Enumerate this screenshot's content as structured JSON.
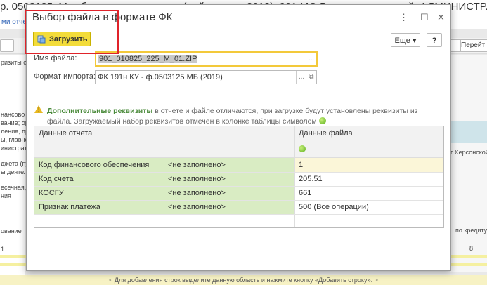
{
  "background": {
    "title": "р. 0503125. Межбюджетные расчеты (действует с 2018), 901 МО Верхнегорачикский, АДМИНИСТРАЦИЯ",
    "link": "ми отчет",
    "next_button": "Перейт",
    "left_texts": [
      "ризиты от",
      "нансово",
      "вание; орг",
      "ления, пр",
      "ы, главно",
      "инистрат",
      "джета (пуб",
      "ы деятельн",
      "есечная, к",
      "ния",
      "ование",
      "1"
    ],
    "right_texts": [
      "т Херсонской",
      "по кредиту",
      "8"
    ],
    "bottom_hint": "< Для добавления строк выделите данную область и нажмите кнопку «Добавить строку». >"
  },
  "dialog": {
    "title": "Выбор файла в формате ФК",
    "controls": {
      "menu": "⋮",
      "maximize": "☐",
      "close": "✕"
    },
    "load_button": "Загрузить",
    "more_button": "Еще",
    "help_button": "?",
    "file_name_label": "Имя файла:",
    "file_name_value": "901_010825_225_M_01.ZIP",
    "dots": "...",
    "format_label": "Формат импорта:",
    "format_value": "ФК 191н КУ - ф.0503125 МБ (2019)",
    "info_bold": "Дополнительные реквизиты",
    "info_text": " в отчете и файле отличаются, при загрузке будут установлены реквизиты из файла. Загружаемый набор реквизитов отмечен в колонке таблицы символом",
    "table": {
      "headers": {
        "report": "Данные отчета",
        "file": "Данные файла"
      },
      "rows": [
        {
          "name": "Код финансового обеспечения",
          "report": "<не заполнено>",
          "file": "1"
        },
        {
          "name": "Код счета",
          "report": "<не заполнено>",
          "file": "205.51"
        },
        {
          "name": "КОСГУ",
          "report": "<не заполнено>",
          "file": "661"
        },
        {
          "name": "Признак платежа",
          "report": "<не заполнено>",
          "file": "500 (Все операции)"
        }
      ]
    }
  },
  "colors": {
    "accent": "#f3dc3a",
    "highlight_box": "#e0232a",
    "green_row": "#d9ecc3",
    "yellow_row": "#fbf6d8"
  }
}
